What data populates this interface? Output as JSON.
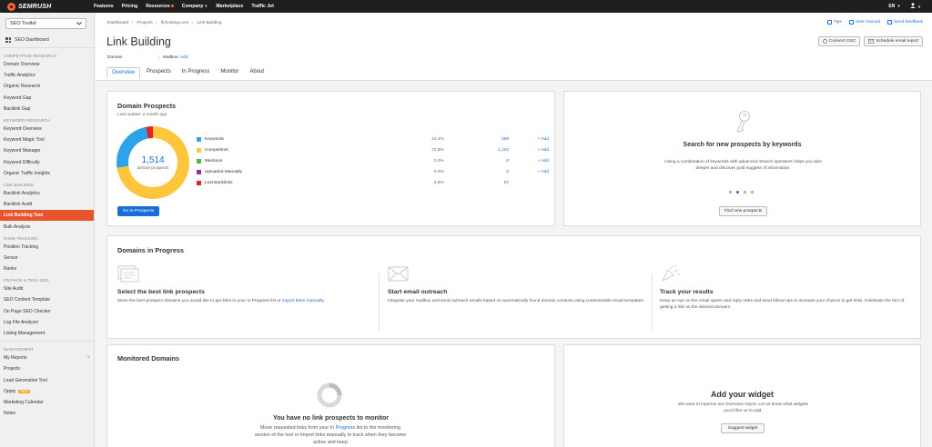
{
  "topbar": {
    "logo": "SEMRUSH",
    "nav": [
      {
        "label": "Features"
      },
      {
        "label": "Pricing"
      },
      {
        "label": "Resources"
      },
      {
        "label": "Company"
      },
      {
        "label": "Marketplace"
      },
      {
        "label": "Traffic Jet"
      }
    ],
    "lang": "EN"
  },
  "sidebar": {
    "toolkit": "SEO Toolkit",
    "dashboard": "SEO Dashboard",
    "sections": [
      {
        "heading": "COMPETITIVE RESEARCH",
        "items": [
          "Domain Overview",
          "Traffic Analytics",
          "Organic Research",
          "Keyword Gap",
          "Backlink Gap"
        ]
      },
      {
        "heading": "KEYWORD RESEARCH",
        "items": [
          "Keyword Overview",
          "Keyword Magic Tool",
          "Keyword Manager",
          "Keyword Difficulty",
          "Organic Traffic Insights"
        ]
      },
      {
        "heading": "LINK BUILDING",
        "items": [
          "Backlink Analytics",
          "Backlink Audit",
          "Link Building Tool",
          "Bulk Analysis"
        ]
      },
      {
        "heading": "RANK TRACKING",
        "items": [
          "Position Tracking",
          "Sensor",
          "Ranks"
        ]
      },
      {
        "heading": "ON PAGE & TECH SEO",
        "items": [
          "Site Audit",
          "SEO Content Template",
          "On Page SEO Checker",
          "Log File Analyzer",
          "Listing Management"
        ]
      },
      {
        "heading": "MANAGEMENT",
        "items": [
          "My Reports",
          "Projects",
          "Lead Generation Tool",
          "Oppty",
          "Marketing Calendar",
          "Notes"
        ]
      }
    ],
    "new_badge": "NEW"
  },
  "header": {
    "breadcrumb": [
      "Dashboard",
      "Projects",
      "lfchosting.com",
      "Link Building"
    ],
    "title": "Link Building",
    "links": [
      "Tips",
      "User manual",
      "Send feedback"
    ],
    "buttons": [
      "Connect GSC",
      "Schedule email report"
    ],
    "domain_label": "Domain",
    "mailbox_label": "Mailbox:",
    "mailbox_add": "Add",
    "tabs": [
      "Overview",
      "Prospects",
      "In Progress",
      "Monitor",
      "About"
    ]
  },
  "prospects": {
    "title": "Domain Prospects",
    "last_update": "Last update: a month ago",
    "total": "1,514",
    "total_label": "domain prospects",
    "rows": [
      {
        "name": "Keywords",
        "pct": "24.4%",
        "value": "369",
        "add": "+ Add",
        "color": "#2da4e9"
      },
      {
        "name": "Competitors",
        "pct": "72.8%",
        "value": "1,102",
        "add": "+ Add",
        "color": "#ffc53d"
      },
      {
        "name": "Mentions",
        "pct": "0.0%",
        "value": "0",
        "add": "+ Add",
        "color": "#57b346"
      },
      {
        "name": "Uploaded Manually",
        "pct": "0.0%",
        "value": "0",
        "add": "+ Add",
        "color": "#9b2d9b"
      },
      {
        "name": "Lost Backlinks",
        "pct": "3.8%",
        "value": "57",
        "add": "",
        "color": "#e2232a"
      }
    ],
    "button": "Go to Prospects"
  },
  "search_card": {
    "title": "Search for new prospects by keywords",
    "text": "Using a combination of keywords with advanced Search operators helps you dive deeper and discover gold nuggets of information.",
    "button": "Find new prospects"
  },
  "in_progress": {
    "title": "Domains in Progress",
    "columns": [
      {
        "title": "Select the best link prospects",
        "text": "Move the best prospect domains you would like to get links to your In Progress list or",
        "link": "import them manually."
      },
      {
        "title": "Start email outreach",
        "text": "Integrate your mailbox and send outreach emails based on automatically found domain contacts using customizable email templates."
      },
      {
        "title": "Track your results",
        "text": "Keep an eye on the email opens and reply rates and send follow-ups to increase your chance to get links. Celebrate the fact of getting a link on the desired domain!"
      }
    ]
  },
  "monitored": {
    "title": "Monitored Domains",
    "empty_title": "You have no link prospects to monitor",
    "text_1": "Move requested links from your",
    "link": "In Progress",
    "text_2": "list to the monitoring section of the tool or import links manually to track when they become active and keep"
  },
  "widget": {
    "title": "Add your widget",
    "text": "We want to improve our Overview report. Let us know what widgets you'd like us to add.",
    "button": "Suggest widget"
  }
}
